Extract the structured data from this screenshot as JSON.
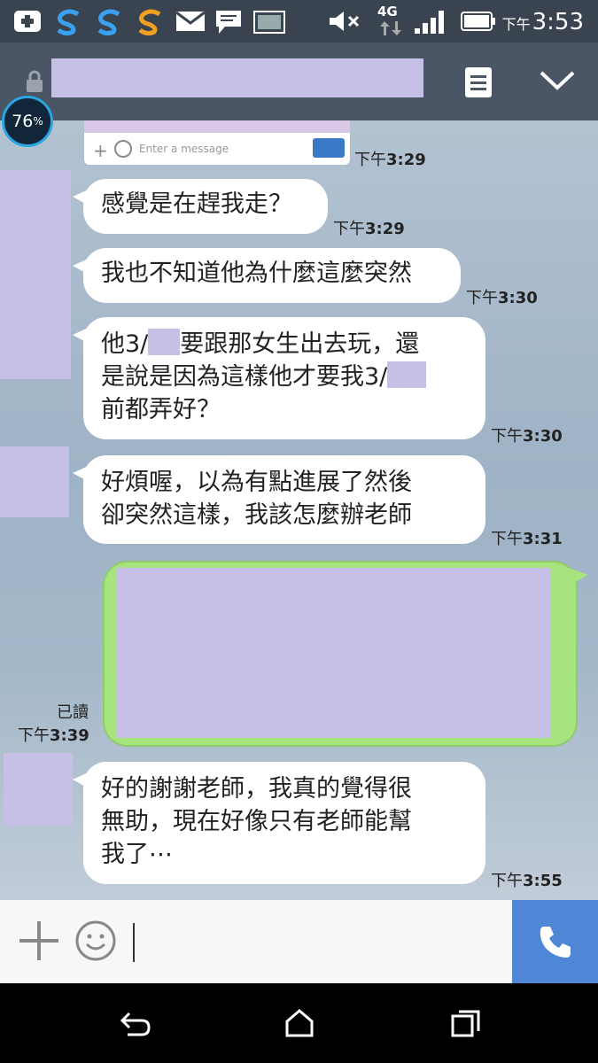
{
  "status_bar": {
    "time_ampm": "下午",
    "time": "3:53",
    "network": "4G",
    "icons": [
      "plus-box-icon",
      "sync-icon",
      "sync-icon",
      "sync-icon",
      "mail-icon",
      "message-icon",
      "image-icon",
      "mute-icon",
      "signal-icon",
      "battery-icon"
    ]
  },
  "header": {
    "icons": [
      "lock-icon",
      "menu-icon",
      "chevron-down-icon"
    ]
  },
  "overlay": {
    "battery_value": "76",
    "battery_unit": "%"
  },
  "chat": {
    "preview_image": {
      "placeholder": "Enter a message"
    },
    "messages": [
      {
        "side": "left",
        "time_ampm": "下午",
        "time": "3:29",
        "text": ""
      },
      {
        "side": "left",
        "time_ampm": "下午",
        "time": "3:29",
        "text": "感覺是在趕我走？"
      },
      {
        "side": "left",
        "time_ampm": "下午",
        "time": "3:30",
        "text": "我也不知道他為什麼這麼突然"
      },
      {
        "side": "left",
        "time_ampm": "下午",
        "time": "3:30",
        "lines": [
          "他3/",
          "要跟那女生出去玩，還",
          "是說是因為這樣他才要我3/",
          "前都弄好？"
        ]
      },
      {
        "side": "left",
        "time_ampm": "下午",
        "time": "3:31",
        "lines": [
          "好煩喔，以為有點進展了然後",
          "卻突然這樣，我該怎麼辦老師"
        ]
      },
      {
        "side": "right",
        "read_label": "已讀",
        "time_ampm": "下午",
        "time": "3:39"
      },
      {
        "side": "left",
        "time_ampm": "下午",
        "time": "3:55",
        "lines": [
          "好的謝謝老師，我真的覺得很",
          "無助，現在好像只有老師能幫",
          "我了⋯"
        ]
      }
    ]
  },
  "input_bar": {
    "icons": [
      "plus-icon",
      "emoji-icon",
      "phone-icon"
    ],
    "accent": "#4f86d6"
  },
  "nav_bar": {
    "icons": [
      "back-icon",
      "home-icon",
      "recents-icon"
    ]
  },
  "colors": {
    "sent_bubble": "#a7e37f",
    "redaction": "#c6bfe6",
    "header": "#4a5566"
  }
}
